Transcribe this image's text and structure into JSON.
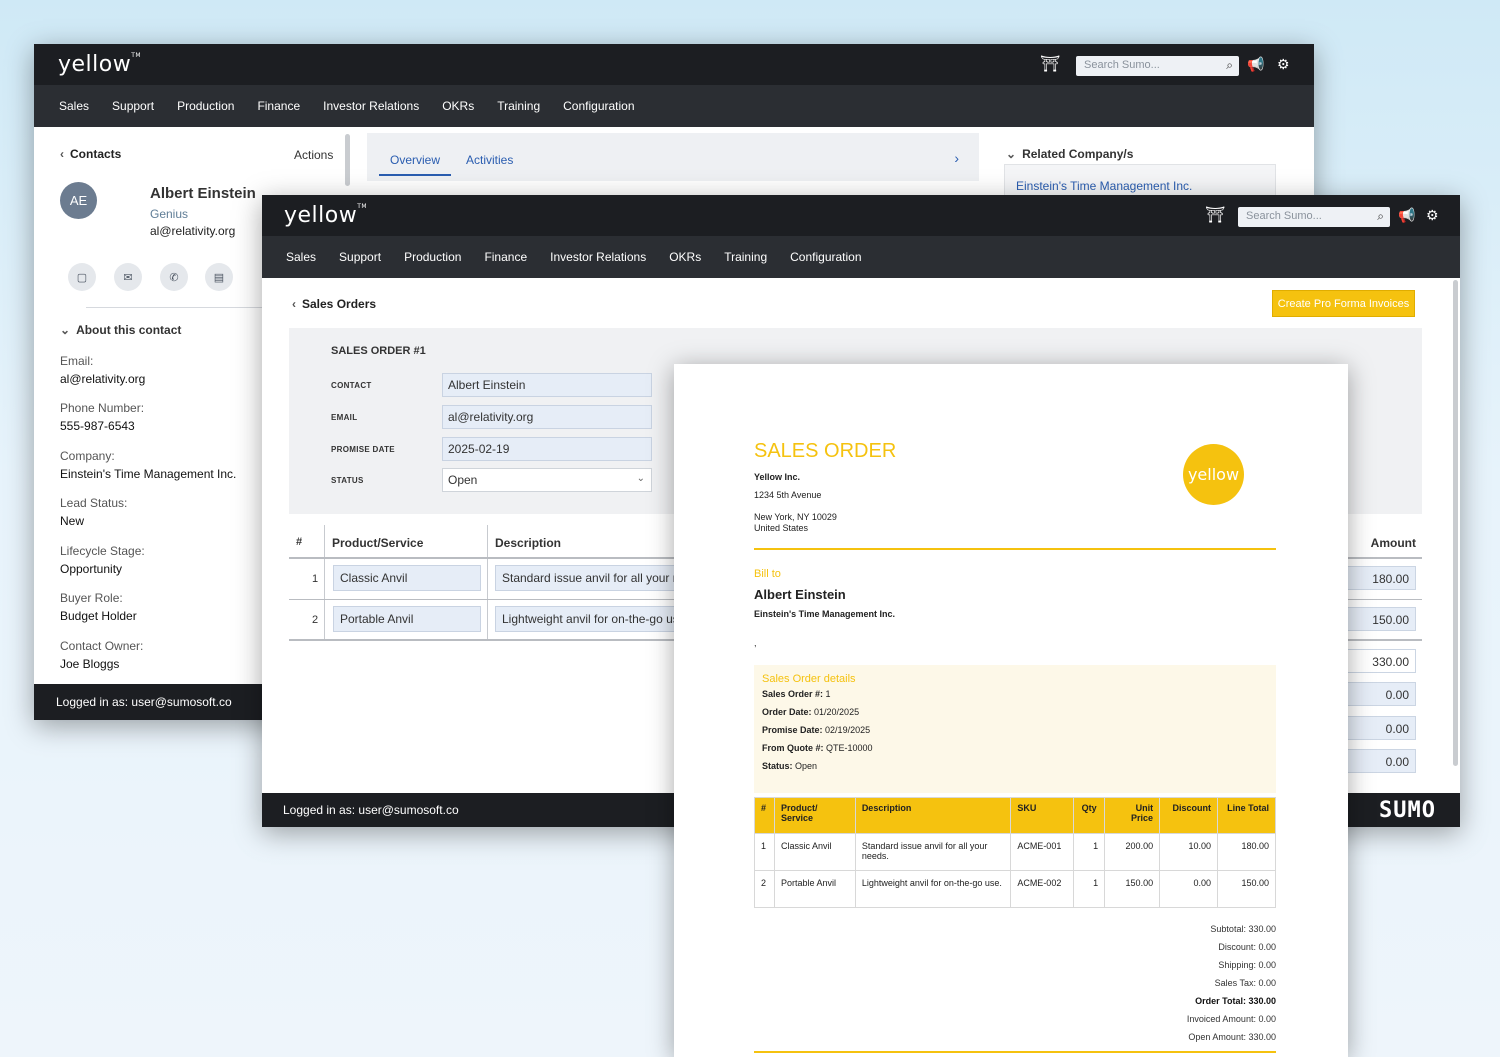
{
  "brand": {
    "logo": "yellow",
    "accent": "#f5c20f",
    "dark": "#1c1e22",
    "nav": "#2b2e33"
  },
  "topbar": {
    "search_placeholder": "Search Sumo..."
  },
  "nav_items": [
    "Sales",
    "Support",
    "Production",
    "Finance",
    "Investor Relations",
    "OKRs",
    "Training",
    "Configuration"
  ],
  "contact": {
    "breadcrumb": "Contacts",
    "actions_label": "Actions",
    "initials": "AE",
    "name": "Albert Einstein",
    "title": "Genius",
    "email": "al@relativity.org",
    "about_header": "About this contact",
    "fields": [
      {
        "label": "Email:",
        "value": "al@relativity.org"
      },
      {
        "label": "Phone Number:",
        "value": "555-987-6543"
      },
      {
        "label": "Company:",
        "value": "Einstein's Time Management Inc."
      },
      {
        "label": "Lead Status:",
        "value": "New"
      },
      {
        "label": "Lifecycle Stage:",
        "value": "Opportunity"
      },
      {
        "label": "Buyer Role:",
        "value": "Budget Holder"
      },
      {
        "label": "Contact Owner:",
        "value": "Joe Bloggs"
      }
    ],
    "tabs": [
      "Overview",
      "Activities"
    ],
    "related_header": "Related Company/s",
    "related_company": "Einstein's Time Management Inc."
  },
  "footer": {
    "logged_in": "Logged in as: user@sumosoft.co",
    "powered_by": "SUMO"
  },
  "sales_orders": {
    "breadcrumb": "Sales Orders",
    "create_button": "Create Pro Forma Invoices",
    "order_title": "SALES ORDER #1",
    "fields": [
      {
        "label": "CONTACT",
        "value": "Albert Einstein"
      },
      {
        "label": "EMAIL",
        "value": "al@relativity.org"
      },
      {
        "label": "PROMISE DATE",
        "value": "2025-02-19"
      },
      {
        "label": "STATUS",
        "value": "Open"
      }
    ],
    "columns": {
      "num": "#",
      "product": "Product/Service",
      "description": "Description",
      "amount": "Amount"
    },
    "rows": [
      {
        "num": "1",
        "product": "Classic Anvil",
        "description": "Standard issue anvil for all your ne",
        "amount": "180.00"
      },
      {
        "num": "2",
        "product": "Portable Anvil",
        "description": "Lightweight anvil for on-the-go use",
        "amount": "150.00"
      }
    ],
    "totals": [
      "330.00",
      "0.00",
      "0.00",
      "0.00"
    ]
  },
  "document": {
    "title": "SALES ORDER",
    "company": "Yellow Inc.",
    "address1": "1234 5th Avenue",
    "address2": "New York, NY 10029",
    "address3": "United States",
    "bill_to_label": "Bill to",
    "bill_name": "Albert Einstein",
    "bill_company": "Einstein's Time Management Inc.",
    "bill_extra": ",",
    "details_header": "Sales Order details",
    "details": [
      {
        "label": "Sales Order #:",
        "value": "1"
      },
      {
        "label": "Order Date:",
        "value": "01/20/2025"
      },
      {
        "label": "Promise Date:",
        "value": "02/19/2025"
      },
      {
        "label": "From Quote #:",
        "value": "QTE-10000"
      },
      {
        "label": "Status:",
        "value": "Open"
      }
    ],
    "table_headers": {
      "num": "#",
      "product": "Product/ Service",
      "description": "Description",
      "sku": "SKU",
      "qty": "Qty",
      "unit_price": "Unit Price",
      "discount": "Discount",
      "line_total": "Line Total"
    },
    "items": [
      {
        "num": "1",
        "product": "Classic Anvil",
        "description": "Standard issue anvil for all your needs.",
        "sku": "ACME-001",
        "qty": "1",
        "unit_price": "200.00",
        "discount": "10.00",
        "line_total": "180.00"
      },
      {
        "num": "2",
        "product": "Portable Anvil",
        "description": "Lightweight anvil for on-the-go use.",
        "sku": "ACME-002",
        "qty": "1",
        "unit_price": "150.00",
        "discount": "0.00",
        "line_total": "150.00"
      }
    ],
    "totals": [
      {
        "label": "Subtotal:",
        "value": "330.00",
        "bold": false
      },
      {
        "label": "Discount:",
        "value": "0.00",
        "bold": false
      },
      {
        "label": "Shipping:",
        "value": "0.00",
        "bold": false
      },
      {
        "label": "Sales Tax:",
        "value": "0.00",
        "bold": false
      },
      {
        "label": "Order Total:",
        "value": "330.00",
        "bold": true
      },
      {
        "label": "Invoiced Amount:",
        "value": "0.00",
        "bold": false
      },
      {
        "label": "Open Amount:",
        "value": "330.00",
        "bold": false
      }
    ]
  }
}
